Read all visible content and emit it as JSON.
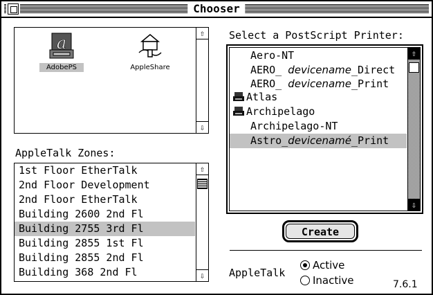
{
  "window": {
    "title": "Chooser"
  },
  "drivers": [
    {
      "label": "AdobePS",
      "icon": "adobe-ps-printer-icon",
      "selected": true
    },
    {
      "label": "AppleShare",
      "icon": "appleshare-server-icon",
      "selected": false
    }
  ],
  "zones": {
    "label": "AppleTalk Zones:",
    "items": [
      "1st Floor EtherTalk",
      "2nd Floor Development",
      "2nd Floor EtherTalk",
      "Building 2600 2nd Fl",
      "Building 2755 3rd Fl",
      "Building 2855 1st Fl",
      "Building 2855 2nd Fl",
      "Building 368 2nd Fl"
    ],
    "selected_index": 4
  },
  "printers": {
    "label": "Select a PostScript Printer:",
    "items": [
      {
        "text": "Aero-NT"
      },
      {
        "prefix": "AERO_ ",
        "italic": "devicename",
        "suffix": "_Direct"
      },
      {
        "prefix": "AERO_ ",
        "italic": "devicename",
        "suffix": "_Print"
      },
      {
        "text": "Atlas",
        "icon": "printer-icon"
      },
      {
        "text": "Archipelago",
        "icon": "printer-icon"
      },
      {
        "text": "Archipelago-NT"
      },
      {
        "prefix": "Astro_",
        "italic": "devicenamé",
        "suffix": "_Print"
      }
    ],
    "selected_index": 6
  },
  "create_button": {
    "label": "Create"
  },
  "appletalk": {
    "label": "AppleTalk",
    "options": [
      "Active",
      "Inactive"
    ],
    "selected": "Active"
  },
  "version": "7.6.1"
}
